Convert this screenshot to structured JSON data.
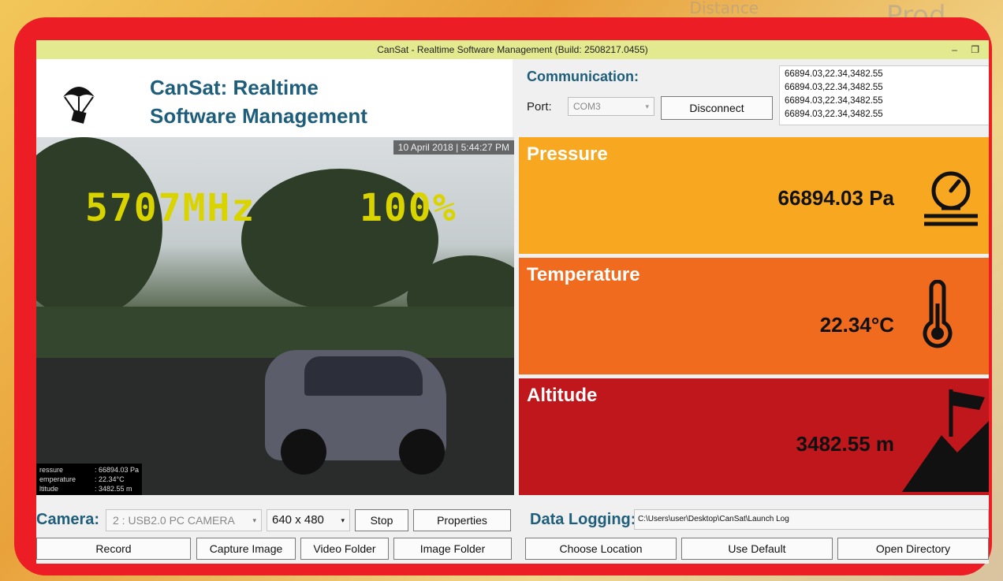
{
  "background": {
    "words": [
      "Distance",
      "Prod..."
    ]
  },
  "window": {
    "title": "CanSat - Realtime Software Management (Build: 2508217.0455)",
    "minimize": "–",
    "restore": "❐"
  },
  "header": {
    "title_line1": "CanSat: Realtime",
    "title_line2": "Software Management",
    "logo_icon": "parachute-icon"
  },
  "communication": {
    "title": "Communication:",
    "port_label": "Port:",
    "port_value": "COM3",
    "disconnect_label": "Disconnect",
    "log_lines": [
      "66894.03,22.34,3482.55",
      "66894.03,22.34,3482.55",
      "66894.03,22.34,3482.55",
      "66894.03,22.34,3482.55"
    ]
  },
  "video": {
    "timestamp": "10 April 2018 | 5:44:27 PM",
    "osd_freq": "5707MHz",
    "osd_signal": "100%",
    "readings": [
      {
        "label": "ressure",
        "value": ": 66894.03 Pa"
      },
      {
        "label": "emperature",
        "value": ": 22.34°C"
      },
      {
        "label": "ltitude",
        "value": ": 3482.55 m"
      }
    ]
  },
  "cards": {
    "pressure": {
      "title": "Pressure",
      "value": "66894.03 Pa",
      "icon": "gauge-icon",
      "color": "#f7a820"
    },
    "temperature": {
      "title": "Temperature",
      "value": "22.34°C",
      "icon": "thermometer-icon",
      "color": "#f06b1e"
    },
    "altitude": {
      "title": "Altitude",
      "value": "3482.55 m",
      "icon": "mountain-flag-icon",
      "color": "#c0171c"
    }
  },
  "camera": {
    "label": "Camera:",
    "device": "2 : USB2.0 PC CAMERA",
    "resolution": "640 x 480",
    "stop_label": "Stop",
    "properties_label": "Properties",
    "record_label": "Record",
    "capture_label": "Capture Image",
    "video_folder_label": "Video Folder",
    "image_folder_label": "Image Folder"
  },
  "logging": {
    "label": "Data Logging:",
    "path": "C:\\Users\\user\\Desktop\\CanSat\\Launch Log",
    "choose_label": "Choose Location",
    "default_label": "Use Default",
    "open_label": "Open Directory"
  },
  "colors": {
    "frame": "#ec1d24",
    "heading": "#1e5e7a",
    "titlebar": "#e3e98f"
  }
}
